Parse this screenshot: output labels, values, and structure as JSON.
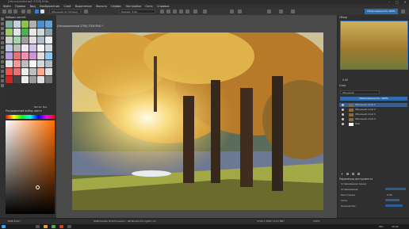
{
  "app": {
    "title": "[Несохранённый 3708] Krita"
  },
  "window_controls": {
    "minimize": "–",
    "maximize": "□",
    "close": "✕"
  },
  "menu": [
    "Файл",
    "Правка",
    "Вид",
    "Изображение",
    "Слой",
    "Выделение",
    "Фильтр",
    "Сервис",
    "Настройка",
    "Окно",
    "Справка"
  ],
  "toolbar": {
    "brush_preset": "Обычный (b) 30 basic",
    "size_label": "Размер: 3.00",
    "mode_button": "Непрозрачность 100%"
  },
  "left_dock": {
    "brushes_title": "Наборы кистей",
    "brush_filter_label": "Метки: Все",
    "color_title": "Расширенный выбор цвета",
    "color_footer": "Выбрать в палитре"
  },
  "canvas": {
    "tab_title": "[Несохранённый 3708] 3708.PNG *"
  },
  "right_dock": {
    "navigator_title": "Обзор",
    "zoom_value": "0.00",
    "layers_title": "Слои",
    "layer_mode": "Обычный",
    "opacity_label": "Непрозрачность: 100%",
    "layers": [
      {
        "name": "Обычный слой 1",
        "visible": true
      },
      {
        "name": "Обычный слой 2",
        "visible": true
      },
      {
        "name": "Обычный слой 3",
        "visible": true
      },
      {
        "name": "Обычный слой 4",
        "visible": true
      },
      {
        "name": "Фон",
        "visible": true
      }
    ],
    "props_title": "Параметры инструмента",
    "props": [
      {
        "label": "Сглаживание линии",
        "value": ""
      },
      {
        "label": "Сглаживание",
        "value": ""
      },
      {
        "label": "Расстояние",
        "value": "0.00"
      },
      {
        "label": "Сила",
        "value": ""
      },
      {
        "label": "Количество",
        "value": ""
      }
    ]
  },
  "status": {
    "left": "RGB 8-бит",
    "center": "RGB/Альфа (8-бит/канал) - sRGB-elle-V2-srgbtrc.icc",
    "right": "3708 x 2560 (14,5 MB)",
    "zoom": "100%"
  },
  "taskbar": {
    "lang": "РУС",
    "time": "15:03"
  },
  "colors": {
    "accent": "#2e6db0",
    "panel": "#2f2f2f",
    "canvas_bg": "#4a4a4a"
  }
}
